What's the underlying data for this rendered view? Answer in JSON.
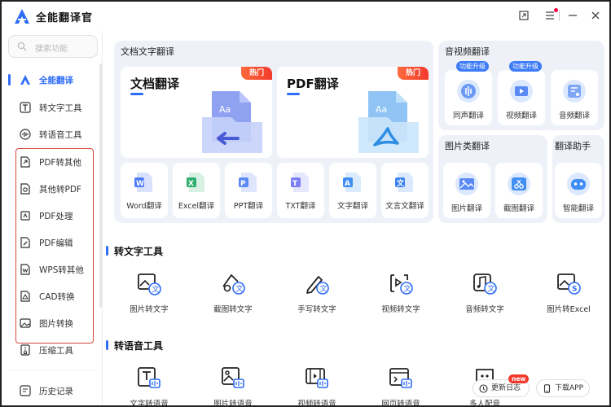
{
  "app": {
    "title": "全能翻译官"
  },
  "window": {
    "restore_icon": "restore-icon",
    "menu_icon": "menu-icon",
    "minimize_icon": "minimize-icon",
    "close_icon": "close-icon"
  },
  "sidebar": {
    "search_placeholder": "搜索功能",
    "items": [
      {
        "label": "全能翻译",
        "icon": "translate-logo-icon",
        "active": true
      },
      {
        "label": "转文字工具",
        "icon": "text-t-icon"
      },
      {
        "label": "转语音工具",
        "icon": "voice-wave-icon"
      },
      {
        "label": "PDF转其他",
        "icon": "pdf-export-icon"
      },
      {
        "label": "其他转PDF",
        "icon": "pdf-import-icon"
      },
      {
        "label": "PDF处理",
        "icon": "pdf-process-icon"
      },
      {
        "label": "PDF编辑",
        "icon": "pdf-edit-icon"
      },
      {
        "label": "WPS转其他",
        "icon": "wps-icon"
      },
      {
        "label": "CAD转换",
        "icon": "cad-icon"
      },
      {
        "label": "图片转换",
        "icon": "image-convert-icon"
      },
      {
        "label": "压缩工具",
        "icon": "compress-icon"
      },
      {
        "label": "历史记录",
        "icon": "history-icon"
      }
    ]
  },
  "doc_translate": {
    "panel_title": "文档文字翻译",
    "big_cards": [
      {
        "title": "文档翻译",
        "badge": "热门"
      },
      {
        "title": "PDF翻译",
        "badge": "热门"
      }
    ],
    "small_cards": [
      {
        "label": "Word翻译",
        "icon": "word-icon"
      },
      {
        "label": "Excel翻译",
        "icon": "excel-icon"
      },
      {
        "label": "PPT翻译",
        "icon": "ppt-icon"
      },
      {
        "label": "TXT翻译",
        "icon": "txt-icon"
      },
      {
        "label": "文字翻译",
        "icon": "text-translate-icon"
      },
      {
        "label": "文言文翻译",
        "icon": "classical-chinese-icon"
      }
    ]
  },
  "av_translate": {
    "panel_title": "音视频翻译",
    "cards": [
      {
        "label": "同声翻译",
        "badge": "功能升级",
        "icon": "simultaneous-icon"
      },
      {
        "label": "视频翻译",
        "badge": "功能升级",
        "icon": "video-translate-icon"
      },
      {
        "label": "音频翻译",
        "badge": "",
        "icon": "audio-translate-icon"
      }
    ]
  },
  "image_translate": {
    "panel_title": "图片类翻译",
    "cards": [
      {
        "label": "图片翻译",
        "icon": "image-translate-icon"
      },
      {
        "label": "截图翻译",
        "icon": "screenshot-translate-icon"
      }
    ]
  },
  "assistant": {
    "panel_title": "翻译助手",
    "cards": [
      {
        "label": "智能翻译",
        "icon": "ai-robot-icon"
      }
    ]
  },
  "text_tools": {
    "title": "转文字工具",
    "items": [
      {
        "label": "图片转文字",
        "icon": "image-to-text-icon"
      },
      {
        "label": "截图转文字",
        "icon": "screenshot-to-text-icon"
      },
      {
        "label": "手写转文字",
        "icon": "handwriting-to-text-icon"
      },
      {
        "label": "视频转文字",
        "icon": "video-to-text-icon"
      },
      {
        "label": "音频转文字",
        "icon": "audio-to-text-icon"
      },
      {
        "label": "图片转Excel",
        "icon": "image-to-excel-icon"
      }
    ]
  },
  "voice_tools": {
    "title": "转语音工具",
    "items": [
      {
        "label": "文字转语音",
        "icon": "text-to-speech-icon"
      },
      {
        "label": "图片转语音",
        "icon": "image-to-speech-icon"
      },
      {
        "label": "视频转语音",
        "icon": "video-to-speech-icon"
      },
      {
        "label": "网页转语音",
        "icon": "webpage-to-speech-icon"
      },
      {
        "label": "多人配音",
        "icon": "multi-dubbing-icon"
      }
    ]
  },
  "floating": {
    "changelog": "更新日志",
    "changelog_badge": "new",
    "download": "下载APP"
  },
  "colors": {
    "accent": "#2d6cf6",
    "hot": "#f23a2c",
    "panel_bg": "#eef1f8",
    "highlight_box": "#d9453b"
  }
}
